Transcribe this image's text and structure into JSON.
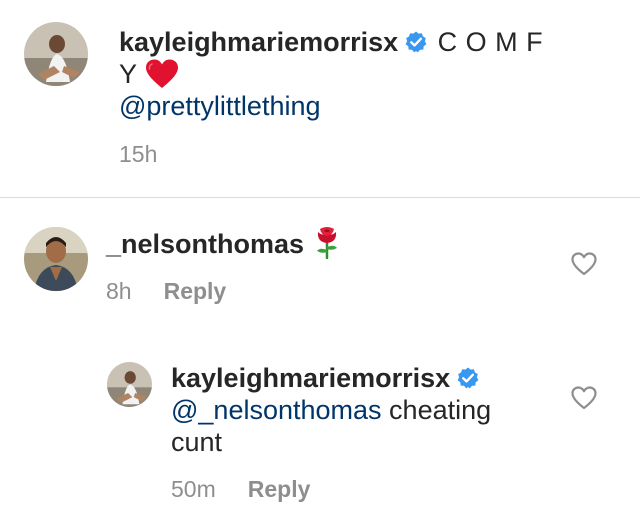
{
  "caption": {
    "username": "kayleighmariemorrisx",
    "text": "C O M F Y",
    "emoji": "red-heart",
    "mention": "@prettylittlething",
    "time": "15h"
  },
  "comments": [
    {
      "username": "_nelsonthomas",
      "emoji": "rose",
      "time": "8h",
      "reply_label": "Reply"
    }
  ],
  "replies": [
    {
      "username": "kayleighmariemorrisx",
      "mention": "@_nelsonthomas",
      "text": "cheating cunt",
      "time": "50m",
      "reply_label": "Reply"
    }
  ],
  "colors": {
    "text": "#262626",
    "meta": "#8e8e8e",
    "mention": "#003569",
    "verified": "#3897f0",
    "divider": "#dbdbdb"
  }
}
